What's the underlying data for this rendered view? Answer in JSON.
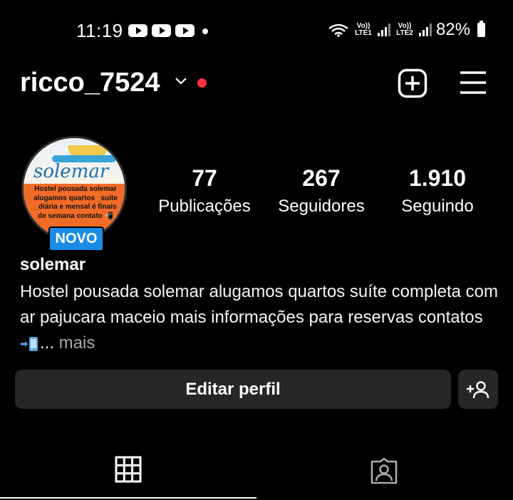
{
  "status_bar": {
    "time": "11:19",
    "notification_icons": [
      "youtube-icon",
      "youtube-icon",
      "youtube-icon"
    ],
    "sim1": "Vo)) LTE1",
    "sim2": "Vo)) LTE2",
    "battery": "82%"
  },
  "header": {
    "username": "ricco_7524",
    "new_post_icon": "plus-square-icon",
    "menu_icon": "hamburger-menu-icon"
  },
  "avatar": {
    "brand": "solemar",
    "text": "Hostel pousada solemar alugamos quartos _suite _diária e mensal é finais de semana contato 📲",
    "badge": "NOVO"
  },
  "stats": [
    {
      "count": "77",
      "label": "Publicações"
    },
    {
      "count": "267",
      "label": "Seguidores"
    },
    {
      "count": "1.910",
      "label": "Seguindo"
    }
  ],
  "profile": {
    "name": "solemar",
    "bio": "Hostel pousada solemar alugamos quartos suíte completa com ar pajucara maceio  mais informações para reservas contatos ",
    "bio_ellipsis": "...",
    "more": " mais"
  },
  "actions": {
    "edit_profile": "Editar perfil",
    "discover_people_icon": "add-person-icon"
  },
  "tabs": [
    {
      "name": "grid",
      "icon": "grid-icon",
      "active": true
    },
    {
      "name": "tagged",
      "icon": "tagged-person-icon",
      "active": false
    }
  ],
  "colors": {
    "background": "#000000",
    "button_bg": "#262626",
    "badge_blue": "#1b8ce6",
    "notification_red": "#ff3040",
    "secondary_text": "#a8a8a8"
  }
}
